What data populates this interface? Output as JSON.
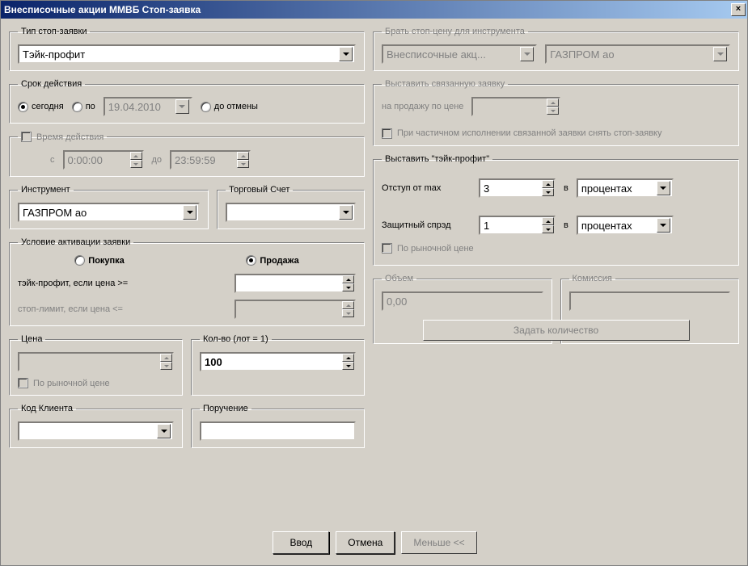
{
  "title": "Внесписочные акции ММВБ Стоп-заявка",
  "close_x": "×",
  "type": {
    "legend": "Тип стоп-заявки",
    "value": "Тэйк-профит"
  },
  "validity": {
    "legend": "Срок действия",
    "today": "сегодня",
    "until": "по",
    "until_date": "19.04.2010",
    "cancel": "до отмены"
  },
  "timebox": {
    "legend": "Время действия",
    "from_lbl": "с",
    "from_val": "0:00:00",
    "to_lbl": "до",
    "to_val": "23:59:59"
  },
  "instrument": {
    "legend": "Инструмент",
    "value": "ГАЗПРОМ ао"
  },
  "account": {
    "legend": "Торговый Счет",
    "value": ""
  },
  "activation": {
    "legend": "Условие активации заявки",
    "buy": "Покупка",
    "sell": "Продажа",
    "tp_lbl": "тэйк-профит, если цена >=",
    "sl_lbl": "стоп-лимит, если цена <="
  },
  "price": {
    "legend": "Цена",
    "market_lbl": "По рыночной цене"
  },
  "qty": {
    "legend": "Кол-во (лот = 1)",
    "value": "100"
  },
  "client_code": {
    "legend": "Код Клиента",
    "value": ""
  },
  "instruction": {
    "legend": "Поручение",
    "value": ""
  },
  "stop_price": {
    "legend": "Брать стоп-цену для инструмента",
    "class_value": "Внесписочные акц...",
    "instr_value": "ГАЗПРОМ ао"
  },
  "linked": {
    "legend": "Выставить связанную заявку",
    "sell_price_lbl": "на продажу по цене",
    "partial_lbl": "При частичном исполнении связанной заявки снять стоп-заявку"
  },
  "takeprofit": {
    "legend": "Выставить \"тэйк-профит\"",
    "offset_lbl": "Отступ от max",
    "offset_val": "3",
    "in_lbl": "в",
    "units": "процентах",
    "spread_lbl": "Защитный спрэд",
    "spread_val": "1",
    "market_lbl": "По рыночной цене"
  },
  "volcom": {
    "volume_legend": "Объем",
    "volume_val": "0,00",
    "commission_legend": "Комиссия",
    "commission_val": "",
    "set_qty_btn": "Задать количество"
  },
  "buttons": {
    "submit": "Ввод",
    "cancel": "Отмена",
    "less": "Меньше <<"
  }
}
